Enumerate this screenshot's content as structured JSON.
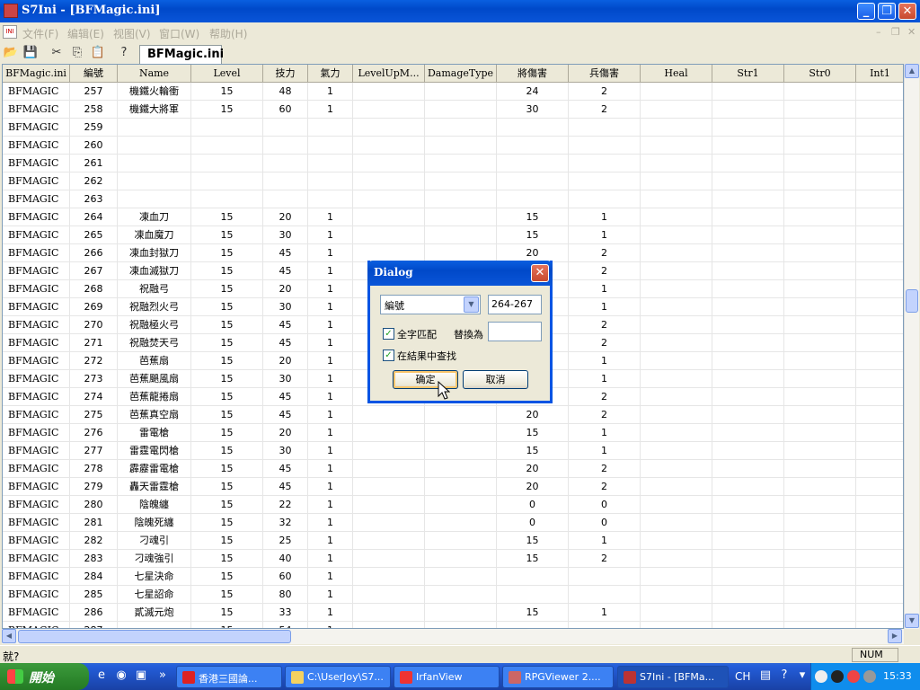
{
  "window": {
    "title": "S7Ini - [BFMagic.ini]"
  },
  "menu": {
    "icon_label": "INI",
    "items": [
      "文件(F)",
      "编辑(E)",
      "视图(V)",
      "窗口(W)",
      "帮助(H)"
    ]
  },
  "tab": {
    "label": "BFMagic.ini"
  },
  "grid": {
    "columns": [
      "BFMagic.ini",
      "編號",
      "Name",
      "Level",
      "技力",
      "氣力",
      "LevelUpM...",
      "DamageType",
      "將傷害",
      "兵傷害",
      "Heal",
      "Str1",
      "Str0",
      "Int1"
    ],
    "rows": [
      [
        "BFMAGIC",
        "257",
        "機鐵火輪衝",
        "15",
        "48",
        "1",
        "",
        "",
        "24",
        "2"
      ],
      [
        "BFMAGIC",
        "258",
        "機鐵大將軍",
        "15",
        "60",
        "1",
        "",
        "",
        "30",
        "2"
      ],
      [
        "BFMAGIC",
        "259",
        "",
        "",
        "",
        "",
        "",
        "",
        "",
        ""
      ],
      [
        "BFMAGIC",
        "260",
        "",
        "",
        "",
        "",
        "",
        "",
        "",
        ""
      ],
      [
        "BFMAGIC",
        "261",
        "",
        "",
        "",
        "",
        "",
        "",
        "",
        ""
      ],
      [
        "BFMAGIC",
        "262",
        "",
        "",
        "",
        "",
        "",
        "",
        "",
        ""
      ],
      [
        "BFMAGIC",
        "263",
        "",
        "",
        "",
        "",
        "",
        "",
        "",
        ""
      ],
      [
        "BFMAGIC",
        "264",
        "凍血刀",
        "15",
        "20",
        "1",
        "",
        "",
        "15",
        "1"
      ],
      [
        "BFMAGIC",
        "265",
        "凍血魔刀",
        "15",
        "30",
        "1",
        "",
        "",
        "15",
        "1"
      ],
      [
        "BFMAGIC",
        "266",
        "凍血封獄刀",
        "15",
        "45",
        "1",
        "",
        "",
        "20",
        "2"
      ],
      [
        "BFMAGIC",
        "267",
        "凍血滅獄刀",
        "15",
        "45",
        "1",
        "",
        "",
        "",
        "2"
      ],
      [
        "BFMAGIC",
        "268",
        "祝融弓",
        "15",
        "20",
        "1",
        "",
        "",
        "",
        "1"
      ],
      [
        "BFMAGIC",
        "269",
        "祝融烈火弓",
        "15",
        "30",
        "1",
        "",
        "",
        "",
        "1"
      ],
      [
        "BFMAGIC",
        "270",
        "祝融極火弓",
        "15",
        "45",
        "1",
        "",
        "",
        "",
        "2"
      ],
      [
        "BFMAGIC",
        "271",
        "祝融焚天弓",
        "15",
        "45",
        "1",
        "",
        "",
        "",
        "2"
      ],
      [
        "BFMAGIC",
        "272",
        "芭蕉扇",
        "15",
        "20",
        "1",
        "",
        "",
        "",
        "1"
      ],
      [
        "BFMAGIC",
        "273",
        "芭蕉颶風扇",
        "15",
        "30",
        "1",
        "",
        "",
        "",
        "1"
      ],
      [
        "BFMAGIC",
        "274",
        "芭蕉龍捲扇",
        "15",
        "45",
        "1",
        "",
        "",
        "",
        "2"
      ],
      [
        "BFMAGIC",
        "275",
        "芭蕉真空扇",
        "15",
        "45",
        "1",
        "",
        "",
        "20",
        "2"
      ],
      [
        "BFMAGIC",
        "276",
        "雷電槍",
        "15",
        "20",
        "1",
        "",
        "",
        "15",
        "1"
      ],
      [
        "BFMAGIC",
        "277",
        "雷霆電閃槍",
        "15",
        "30",
        "1",
        "",
        "",
        "15",
        "1"
      ],
      [
        "BFMAGIC",
        "278",
        "霹靂雷電槍",
        "15",
        "45",
        "1",
        "",
        "",
        "20",
        "2"
      ],
      [
        "BFMAGIC",
        "279",
        "轟天雷霆槍",
        "15",
        "45",
        "1",
        "",
        "",
        "20",
        "2"
      ],
      [
        "BFMAGIC",
        "280",
        "陰魄纏",
        "15",
        "22",
        "1",
        "",
        "",
        "0",
        "0"
      ],
      [
        "BFMAGIC",
        "281",
        "陰魄死纏",
        "15",
        "32",
        "1",
        "",
        "",
        "0",
        "0"
      ],
      [
        "BFMAGIC",
        "282",
        "刁魂引",
        "15",
        "25",
        "1",
        "",
        "",
        "15",
        "1"
      ],
      [
        "BFMAGIC",
        "283",
        "刁魂強引",
        "15",
        "40",
        "1",
        "",
        "",
        "15",
        "2"
      ],
      [
        "BFMAGIC",
        "284",
        "七星決命",
        "15",
        "60",
        "1",
        "",
        "",
        "",
        ""
      ],
      [
        "BFMAGIC",
        "285",
        "七星詔命",
        "15",
        "80",
        "1",
        "",
        "",
        "",
        ""
      ],
      [
        "BFMAGIC",
        "286",
        "貳滅元炮",
        "15",
        "33",
        "1",
        "",
        "",
        "15",
        "1"
      ],
      [
        "BFMAGIC",
        "287",
        "",
        "15",
        "54",
        "1",
        "",
        "",
        "",
        ""
      ]
    ]
  },
  "dialog": {
    "title": "Dialog",
    "field_select": "編號",
    "search_value": "264-267",
    "replace_value": "",
    "whole_word_label": "全字匹配",
    "replace_label": "替換為",
    "in_results_label": "在結果中查找",
    "ok_label": "确定",
    "cancel_label": "取消"
  },
  "status": {
    "text": "就?",
    "num": "NUM"
  },
  "taskbar": {
    "start_label": "開始",
    "tasks": [
      "香港三國論...",
      "C:\\UserJoy\\S7...",
      "IrfanView",
      "RPGViewer 2....",
      "S7Ini - [BFMa..."
    ],
    "lang": "CH",
    "clock": "15:33"
  }
}
